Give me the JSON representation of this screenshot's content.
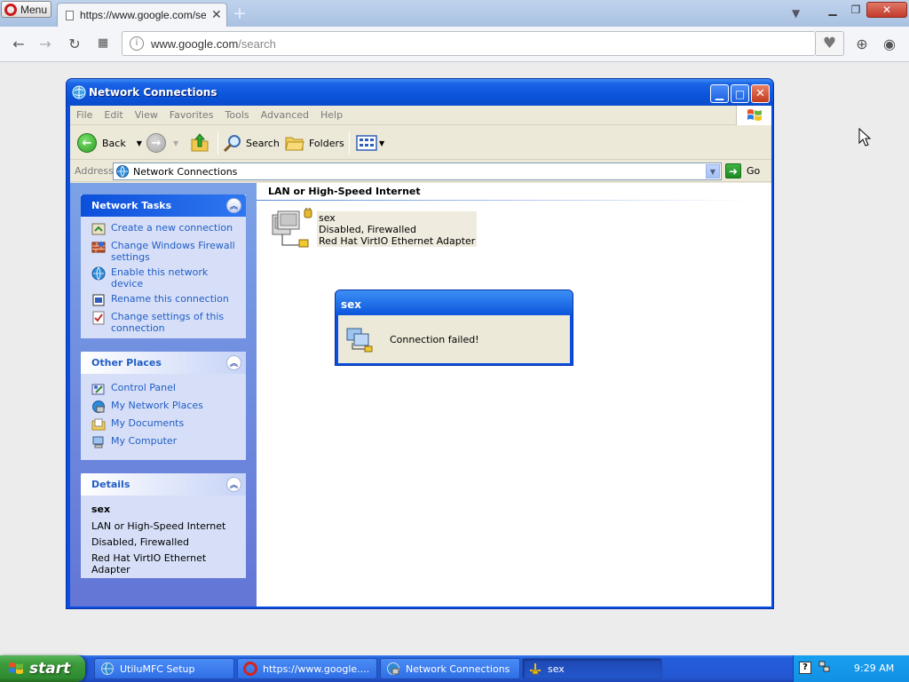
{
  "browser": {
    "menu_label": "Menu",
    "tab_title": "https://www.google.com/sea",
    "new_tab": "+",
    "url_host": "www.google.com",
    "url_path": "/search"
  },
  "window": {
    "title": "Network Connections",
    "menu": [
      "File",
      "Edit",
      "View",
      "Favorites",
      "Tools",
      "Advanced",
      "Help"
    ],
    "toolbar": {
      "back": "Back",
      "search": "Search",
      "folders": "Folders"
    },
    "address": {
      "label": "Address",
      "value": "Network Connections",
      "go": "Go"
    }
  },
  "task_pane": {
    "network_tasks": {
      "title": "Network Tasks",
      "items": [
        {
          "label": "Create a new connection",
          "icon": "new-connection-icon"
        },
        {
          "label": "Change Windows Firewall settings",
          "icon": "firewall-icon"
        },
        {
          "label": "Enable this network device",
          "icon": "enable-device-icon"
        },
        {
          "label": "Rename this connection",
          "icon": "rename-icon"
        },
        {
          "label": "Change settings of this connection",
          "icon": "settings-icon"
        }
      ]
    },
    "other_places": {
      "title": "Other Places",
      "items": [
        {
          "label": "Control Panel",
          "icon": "control-panel-icon"
        },
        {
          "label": "My Network Places",
          "icon": "network-places-icon"
        },
        {
          "label": "My Documents",
          "icon": "documents-icon"
        },
        {
          "label": "My Computer",
          "icon": "computer-icon"
        }
      ]
    },
    "details": {
      "title": "Details",
      "name": "sex",
      "type": "LAN or High-Speed Internet",
      "status": "Disabled, Firewalled",
      "adapter": "Red Hat VirtIO Ethernet Adapter"
    }
  },
  "content": {
    "group_header": "LAN or High-Speed Internet",
    "connection": {
      "name": "sex",
      "status": "Disabled, Firewalled",
      "adapter": "Red Hat VirtIO Ethernet Adapter"
    }
  },
  "popup": {
    "title": "sex",
    "message": "Connection failed!"
  },
  "taskbar": {
    "start": "start",
    "tasks": [
      {
        "label": "UtiluMFC Setup",
        "icon": "setup-icon"
      },
      {
        "label": "https://www.google....",
        "icon": "opera-icon"
      },
      {
        "label": "Network Connections",
        "icon": "network-connections-icon"
      },
      {
        "label": "sex",
        "icon": "lan-icon"
      }
    ],
    "clock": "9:29 AM"
  },
  "colors": {
    "xp_blue": "#0a4ee0",
    "task_link": "#215dc6",
    "start_green": "#3c9d3c"
  }
}
